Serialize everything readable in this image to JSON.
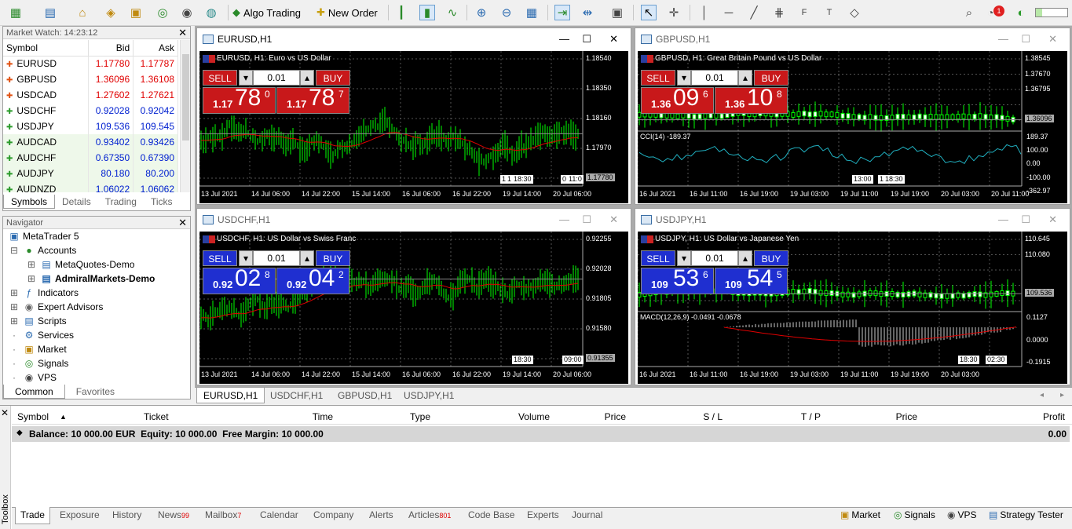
{
  "toolbar": {
    "algo_trading": "Algo Trading",
    "new_order": "New Order",
    "notification_count": "1"
  },
  "market_watch": {
    "title": "Market Watch: 14:23:12",
    "columns": [
      "Symbol",
      "Bid",
      "Ask"
    ],
    "rows": [
      {
        "symbol": "EURUSD",
        "bid": "1.17780",
        "ask": "1.17787",
        "dir": "down"
      },
      {
        "symbol": "GBPUSD",
        "bid": "1.36096",
        "ask": "1.36108",
        "dir": "down"
      },
      {
        "symbol": "USDCAD",
        "bid": "1.27602",
        "ask": "1.27621",
        "dir": "down"
      },
      {
        "symbol": "USDCHF",
        "bid": "0.92028",
        "ask": "0.92042",
        "dir": "up"
      },
      {
        "symbol": "USDJPY",
        "bid": "109.536",
        "ask": "109.545",
        "dir": "up"
      },
      {
        "symbol": "AUDCAD",
        "bid": "0.93402",
        "ask": "0.93426",
        "dir": "up"
      },
      {
        "symbol": "AUDCHF",
        "bid": "0.67350",
        "ask": "0.67390",
        "dir": "up"
      },
      {
        "symbol": "AUDJPY",
        "bid": "80.180",
        "ask": "80.200",
        "dir": "up"
      },
      {
        "symbol": "AUDNZD",
        "bid": "1.06022",
        "ask": "1.06062",
        "dir": "up"
      }
    ],
    "tabs": [
      "Symbols",
      "Details",
      "Trading",
      "Ticks"
    ]
  },
  "navigator": {
    "title": "Navigator",
    "root": "MetaTrader 5",
    "accounts": "Accounts",
    "account1": "MetaQuotes-Demo",
    "account2": "AdmiralMarkets-Demo",
    "items": [
      "Indicators",
      "Expert Advisors",
      "Scripts",
      "Services",
      "Market",
      "Signals",
      "VPS"
    ],
    "tabs": [
      "Common",
      "Favorites"
    ]
  },
  "charts": [
    {
      "window_title": "EURUSD,H1",
      "chart_title": "EURUSD, H1:  Euro vs US Dollar",
      "sell_label": "SELL",
      "buy_label": "BUY",
      "lot": "0.01",
      "sell_pre": "1.17",
      "sell_big": "78",
      "sell_sup": "0",
      "buy_pre": "1.17",
      "buy_big": "78",
      "buy_sup": "7",
      "theme": "#c8181a",
      "y_ticks": [
        "1.18540",
        "1.18350",
        "1.18160",
        "1.17970",
        "1.17780"
      ],
      "x_ticks": [
        "13 Jul 2021",
        "14 Jul 06:00",
        "14 Jul 22:00",
        "15 Jul 14:00",
        "16 Jul 06:00",
        "16 Jul 22:00",
        "19 Jul 14:00",
        "20 Jul 06:00"
      ],
      "tags": [
        "1",
        "1",
        "18:30",
        "0",
        "11:0"
      ]
    },
    {
      "window_title": "GBPUSD,H1",
      "chart_title": "GBPUSD, H1:  Great Britain Pound vs US Dollar",
      "sell_label": "SELL",
      "buy_label": "BUY",
      "lot": "0.01",
      "sell_pre": "1.36",
      "sell_big": "09",
      "sell_sup": "6",
      "buy_pre": "1.36",
      "buy_big": "10",
      "buy_sup": "8",
      "theme": "#c8181a",
      "y_ticks": [
        "1.38545",
        "1.37670",
        "1.36795",
        "1.36096"
      ],
      "x_ticks": [
        "16 Jul 2021",
        "16 Jul 11:00",
        "16 Jul 19:00",
        "19 Jul 03:00",
        "19 Jul 11:00",
        "19 Jul 19:00",
        "20 Jul 03:00",
        "20 Jul 11:00"
      ],
      "tags": [
        "13:00",
        "1",
        "18:30"
      ],
      "indicator": "CCI(14) -189.37",
      "ind_ticks": [
        "189.37",
        "100.00",
        "0.00",
        "-100.00",
        "-362.97"
      ]
    },
    {
      "window_title": "USDCHF,H1",
      "chart_title": "USDCHF, H1:  US Dollar vs Swiss Franc",
      "sell_label": "SELL",
      "buy_label": "BUY",
      "lot": "0.01",
      "sell_pre": "0.92",
      "sell_big": "02",
      "sell_sup": "8",
      "buy_pre": "0.92",
      "buy_big": "04",
      "buy_sup": "2",
      "theme": "#1f2fd0",
      "y_ticks": [
        "0.92255",
        "0.92028",
        "0.91805",
        "0.91580",
        "0.91355"
      ],
      "x_ticks": [
        "13 Jul 2021",
        "14 Jul 06:00",
        "14 Jul 22:00",
        "15 Jul 14:00",
        "16 Jul 06:00",
        "16 Jul 22:00",
        "19 Jul 14:00",
        "20 Jul 06:00"
      ],
      "tags": [
        "18:30",
        "09:00"
      ]
    },
    {
      "window_title": "USDJPY,H1",
      "chart_title": "USDJPY, H1:  US Dollar vs Japanese Yen",
      "sell_label": "SELL",
      "buy_label": "BUY",
      "lot": "0.01",
      "sell_pre": "109",
      "sell_big": "53",
      "sell_sup": "6",
      "buy_pre": "109",
      "buy_big": "54",
      "buy_sup": "5",
      "theme": "#1f2fd0",
      "y_ticks": [
        "110.645",
        "110.080",
        "109.536"
      ],
      "x_ticks": [
        "16 Jul 2021",
        "16 Jul 11:00",
        "16 Jul 19:00",
        "19 Jul 03:00",
        "19 Jul 11:00",
        "19 Jul 19:00",
        "20 Jul 03:00"
      ],
      "tags": [
        "18:30",
        "02:30"
      ],
      "indicator": "MACD(12,26,9) -0.0491 -0.0678",
      "ind_ticks": [
        "0.1127",
        "0.0000",
        "-0.1915"
      ]
    }
  ],
  "chart_tabs": [
    "EURUSD,H1",
    "USDCHF,H1",
    "GBPUSD,H1",
    "USDJPY,H1"
  ],
  "toolbox": {
    "columns": [
      "Symbol",
      "Ticket",
      "Time",
      "Type",
      "Volume",
      "Price",
      "S / L",
      "T / P",
      "Price",
      "Profit"
    ],
    "balance_line": "Balance: 10 000.00 EUR  Equity: 10 000.00  Free Margin: 10 000.00",
    "profit": "0.00",
    "side_label": "Toolbox",
    "tabs": [
      {
        "label": "Trade",
        "badge": ""
      },
      {
        "label": "Exposure",
        "badge": ""
      },
      {
        "label": "History",
        "badge": ""
      },
      {
        "label": "News",
        "badge": "99"
      },
      {
        "label": "Mailbox",
        "badge": "7"
      },
      {
        "label": "Calendar",
        "badge": ""
      },
      {
        "label": "Company",
        "badge": ""
      },
      {
        "label": "Alerts",
        "badge": ""
      },
      {
        "label": "Articles",
        "badge": "801"
      },
      {
        "label": "Code Base",
        "badge": ""
      },
      {
        "label": "Experts",
        "badge": ""
      },
      {
        "label": "Journal",
        "badge": ""
      }
    ],
    "right_tabs": [
      "Market",
      "Signals",
      "VPS",
      "Strategy Tester"
    ]
  }
}
